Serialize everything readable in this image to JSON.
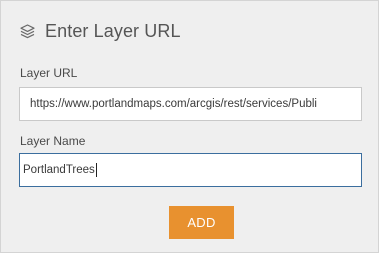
{
  "header": {
    "icon": "layers-icon",
    "title": "Enter Layer URL"
  },
  "form": {
    "url_label": "Layer URL",
    "url_value": "https://www.portlandmaps.com/arcgis/rest/services/Publi",
    "name_label": "Layer Name",
    "name_value": "PortlandTrees",
    "add_label": "ADD"
  },
  "colors": {
    "panel_bg": "#efefef",
    "button_accent": "#e8912f",
    "focus_border": "#3b6e9e"
  }
}
